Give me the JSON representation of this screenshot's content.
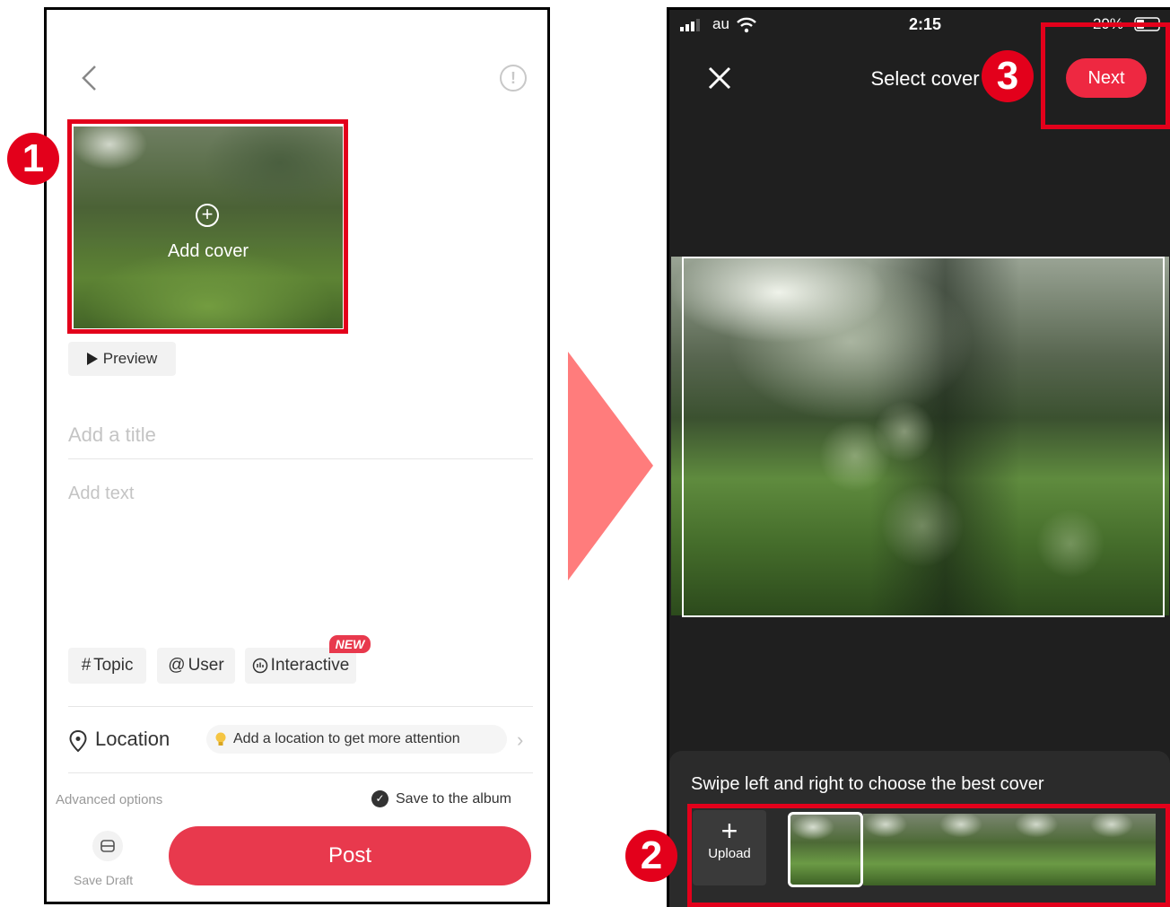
{
  "left": {
    "cover_label": "Add cover",
    "preview_label": "Preview",
    "title_placeholder": "Add a title",
    "text_placeholder": "Add text",
    "chips": {
      "topic": "Topic",
      "topic_symbol": "#",
      "user": "User",
      "user_symbol": "@",
      "interactive": "Interactive",
      "new_badge": "NEW"
    },
    "location": {
      "label": "Location",
      "hint": "Add a location to get more attention"
    },
    "advanced_options": "Advanced options",
    "save_to_album": "Save to the album",
    "save_draft": "Save Draft",
    "post": "Post"
  },
  "right": {
    "status": {
      "carrier": "au",
      "time": "2:15",
      "battery": "29%"
    },
    "title": "Select cover",
    "next": "Next",
    "hint": "Swipe left and right to choose the best cover",
    "upload": "Upload",
    "upload_symbol": "+"
  },
  "steps": [
    "1",
    "2",
    "3"
  ],
  "colors": {
    "accent_red": "#e8394d",
    "annotation_red": "#e3001b",
    "arrow": "#ff7c7c",
    "dark_bg": "#1f1f1f"
  }
}
